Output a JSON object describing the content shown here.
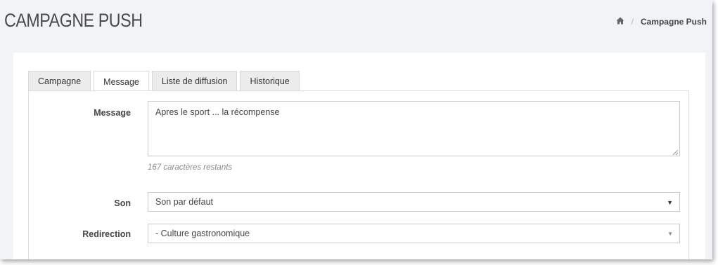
{
  "header": {
    "title": "CAMPAGNE PUSH",
    "breadcrumb": {
      "home_icon": "home-icon",
      "separator": "/",
      "current": "Campagne Push"
    }
  },
  "tabs": [
    {
      "label": "Campagne",
      "active": false
    },
    {
      "label": "Message",
      "active": true
    },
    {
      "label": "Liste de diffusion",
      "active": false
    },
    {
      "label": "Historique",
      "active": false
    }
  ],
  "form": {
    "message": {
      "label": "Message",
      "value": "Apres le sport ... la récompense",
      "help": "167 caractères restants"
    },
    "son": {
      "label": "Son",
      "selected": "Son par défaut"
    },
    "redirection": {
      "label": "Redirection",
      "selected": "- Culture gastronomique"
    }
  }
}
